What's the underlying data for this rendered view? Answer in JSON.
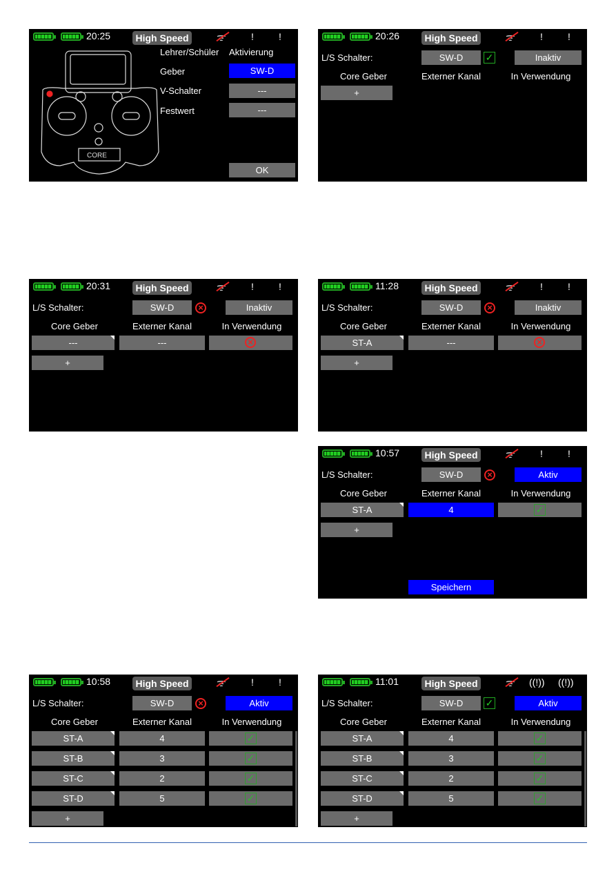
{
  "colors": {
    "accent": "#0000ff",
    "button": "#6b6b6b",
    "ok": "#22aa22",
    "error": "#ee2222"
  },
  "screen1": {
    "time": "20:25",
    "mode": "High Speed",
    "title1": "Lehrer/Schüler",
    "title2": "Aktivierung",
    "rows": [
      {
        "label": "Geber",
        "value": "SW-D",
        "selected": true
      },
      {
        "label": "V-Schalter",
        "value": "---",
        "selected": false
      },
      {
        "label": "Festwert",
        "value": "---",
        "selected": false
      }
    ],
    "ok": "OK",
    "logo": "CORE"
  },
  "screens": [
    {
      "time": "20:26",
      "mode": "High Speed",
      "ls_label": "L/S Schalter:",
      "switch": "SW-D",
      "switch_state": "check",
      "status": "Inaktiv",
      "status_active": false,
      "headers": [
        "Core Geber",
        "Externer Kanal",
        "In Verwendung"
      ],
      "rows": [],
      "plus": "+",
      "antenna": "single",
      "scroll": false
    },
    {
      "time": "20:31",
      "mode": "High Speed",
      "ls_label": "L/S Schalter:",
      "switch": "SW-D",
      "switch_state": "x",
      "status": "Inaktiv",
      "status_active": false,
      "headers": [
        "Core Geber",
        "Externer Kanal",
        "In Verwendung"
      ],
      "rows": [
        {
          "geber": "---",
          "kanal": "---",
          "use": "x",
          "kanal_selected": false
        }
      ],
      "plus": "+",
      "antenna": "single",
      "scroll": false
    },
    {
      "time": "11:28",
      "mode": "High Speed",
      "ls_label": "L/S Schalter:",
      "switch": "SW-D",
      "switch_state": "x",
      "status": "Inaktiv",
      "status_active": false,
      "headers": [
        "Core Geber",
        "Externer Kanal",
        "In Verwendung"
      ],
      "rows": [
        {
          "geber": "ST-A",
          "kanal": "---",
          "use": "x",
          "kanal_selected": false
        }
      ],
      "plus": "+",
      "antenna": "single",
      "scroll": false
    },
    {
      "time": "10:57",
      "mode": "High Speed",
      "ls_label": "L/S Schalter:",
      "switch": "SW-D",
      "switch_state": "x",
      "status": "Aktiv",
      "status_active": true,
      "headers": [
        "Core Geber",
        "Externer Kanal",
        "In Verwendung"
      ],
      "rows": [
        {
          "geber": "ST-A",
          "kanal": "4",
          "use": "check",
          "kanal_selected": true
        }
      ],
      "plus": "+",
      "save": "Speichern",
      "antenna": "single",
      "scroll": false
    },
    {
      "time": "10:58",
      "mode": "High Speed",
      "ls_label": "L/S Schalter:",
      "switch": "SW-D",
      "switch_state": "x",
      "status": "Aktiv",
      "status_active": true,
      "headers": [
        "Core Geber",
        "Externer Kanal",
        "In Verwendung"
      ],
      "rows": [
        {
          "geber": "ST-A",
          "kanal": "4",
          "use": "check"
        },
        {
          "geber": "ST-B",
          "kanal": "3",
          "use": "check"
        },
        {
          "geber": "ST-C",
          "kanal": "2",
          "use": "check"
        },
        {
          "geber": "ST-D",
          "kanal": "5",
          "use": "check"
        }
      ],
      "plus": "+",
      "antenna": "single",
      "scroll": true
    },
    {
      "time": "11:01",
      "mode": "High Speed",
      "ls_label": "L/S Schalter:",
      "switch": "SW-D",
      "switch_state": "check",
      "status": "Aktiv",
      "status_active": true,
      "headers": [
        "Core Geber",
        "Externer Kanal",
        "In Verwendung"
      ],
      "rows": [
        {
          "geber": "ST-A",
          "kanal": "4",
          "use": "check"
        },
        {
          "geber": "ST-B",
          "kanal": "3",
          "use": "check"
        },
        {
          "geber": "ST-C",
          "kanal": "2",
          "use": "check"
        },
        {
          "geber": "ST-D",
          "kanal": "5",
          "use": "check"
        }
      ],
      "plus": "+",
      "antenna": "signal",
      "scroll": true
    }
  ]
}
